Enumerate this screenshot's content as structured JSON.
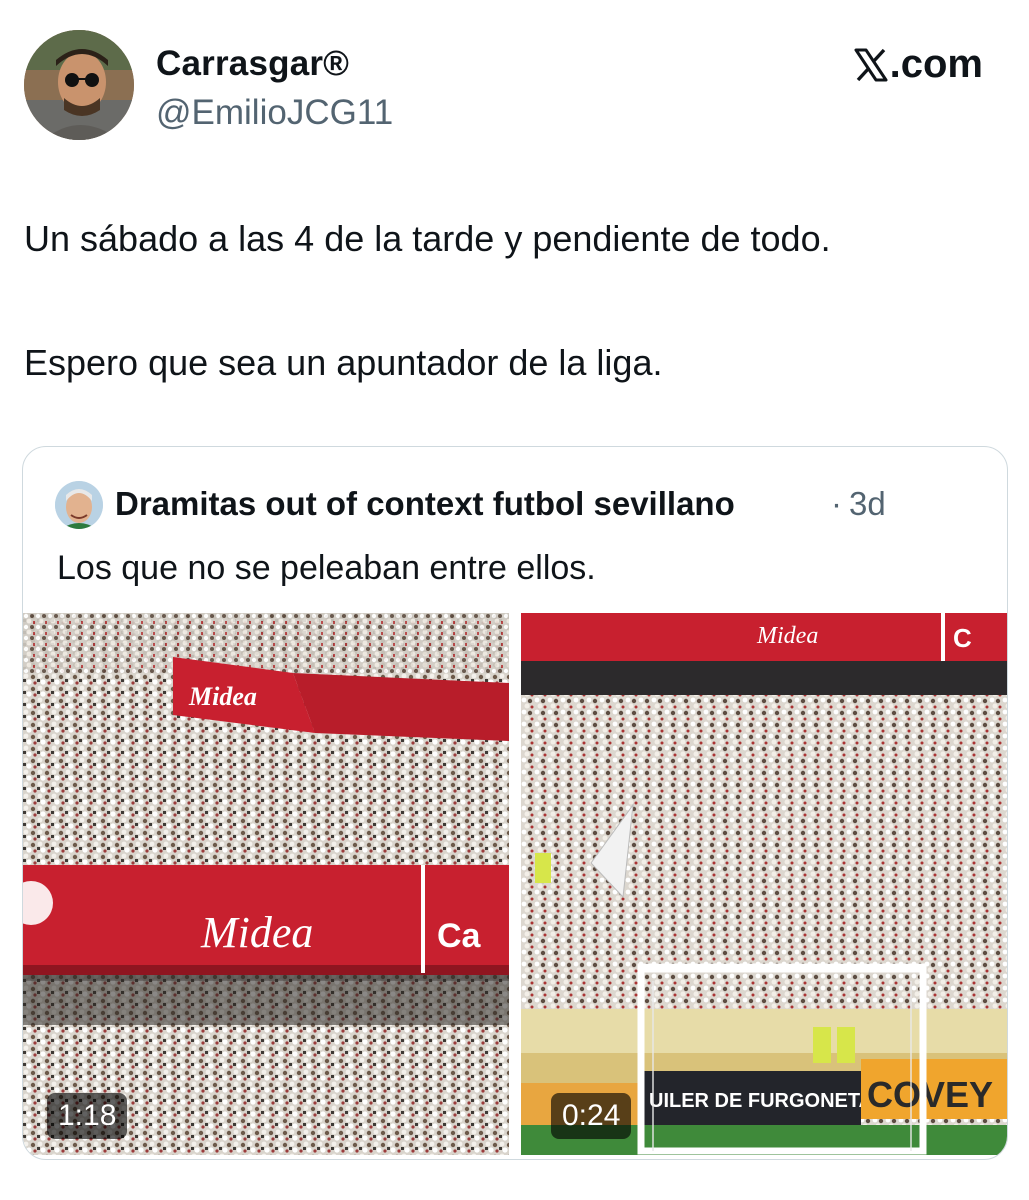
{
  "author": {
    "name": "Carrasgar®",
    "handle": "@EmilioJCG11"
  },
  "brand": {
    "logo_text": ".com",
    "icon": "x-logo-icon"
  },
  "tweet": {
    "line1": "Un sábado a las 4 de la tarde y pendiente de todo.",
    "line2": "Espero que sea un apuntador de la liga."
  },
  "quote": {
    "author_name": "Dramitas out of context futbol sevillano",
    "separator": "·",
    "time": "3d",
    "text": "Los que no se peleaban entre ellos."
  },
  "media": {
    "left": {
      "duration": "1:18",
      "banner_text": "Midea",
      "top_banner_text": "Midea",
      "sponsor_text": "Ca"
    },
    "right": {
      "duration": "0:24",
      "top_banner_text": "Midea",
      "sponsor_text": "C",
      "ad_board_text": "UILER DE FURGONETAS",
      "ad_brand_text": "COVEY"
    }
  },
  "colors": {
    "text": "#0f1419",
    "secondary": "#536471",
    "border": "#cfd9de",
    "stadium_red": "#c8202f",
    "pitch_green": "#3f8a3a"
  }
}
